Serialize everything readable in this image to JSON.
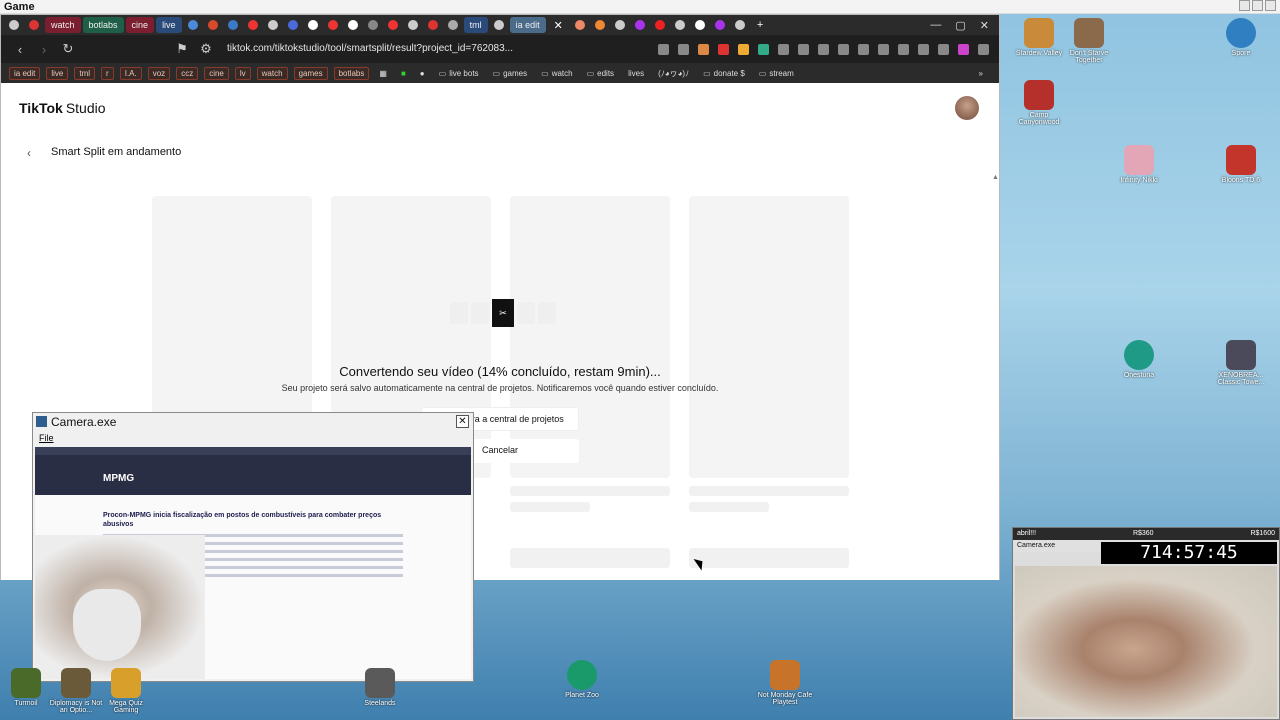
{
  "window": {
    "title": "Game"
  },
  "tabs": [
    "watch",
    "botlabs",
    "cine",
    "live",
    "tml",
    "ia edit"
  ],
  "browser": {
    "url": "tiktok.com/tiktokstudio/tool/smartsplit/result?project_id=762083...",
    "bookmarks": [
      "ia edit",
      "live",
      "tml",
      "r",
      "I.A.",
      "voz",
      "ccz",
      "cine",
      "lv",
      "watch",
      "games",
      "botlabs",
      "live bots",
      "games",
      "watch",
      "edits",
      "lives",
      "(ﾉ◕ヮ◕)ﾉ",
      "donate $",
      "stream"
    ]
  },
  "page": {
    "brand": "TikTok",
    "brand_suffix": "Studio",
    "back_icon": "chevron-left-icon",
    "title": "Smart Split em andamento",
    "progress": {
      "headline": "Convertendo seu vídeo (14% concluído, restam 9min)...",
      "subtext": "Seu projeto será salvo automaticamente na central de projetos. Notificaremos você quando estiver concluído.",
      "percent": 14
    },
    "primary_button": "Voltar para a central de projetos",
    "cancel_button": "Cancelar"
  },
  "camera_window": {
    "title": "Camera.exe",
    "menu": "File",
    "article_heading": "Procon-MPMG inicia fiscalização em postos de combustíveis para combater preços abusivos",
    "site_logo": "MPMG"
  },
  "desktop_icons": [
    {
      "label": "Stardew Valley",
      "color": "#c98a3a"
    },
    {
      "label": "Don't Starve Together",
      "color": "#8a6a4a"
    },
    {
      "label": "Spore",
      "color": "#2f7fc1"
    },
    {
      "label": "Camp Canyonwood",
      "color": "#b5302a"
    },
    {
      "label": "Infinity Nikki",
      "color": "#e3a6b6"
    },
    {
      "label": "Bloons TD 6",
      "color": "#c3342a"
    },
    {
      "label": "Onestuna",
      "color": "#1f9a86"
    },
    {
      "label": "XENOBREA... Classic Towe...",
      "color": "#4a4a5a"
    }
  ],
  "stream_overlay": {
    "left_text": "abril!!!",
    "mid_text": "R$360",
    "right_text": "R$1600",
    "camera_title": "Camera.exe",
    "timer": "714:57:45"
  },
  "taskbar_icons": [
    {
      "label": "Turmoil",
      "color": "#4a6a2a"
    },
    {
      "label": "Diplomacy is Not an Optio...",
      "color": "#6a5a3a"
    },
    {
      "label": "Mega Quiz Gaming",
      "color": "#d8a02a"
    },
    {
      "label": "Steelands",
      "color": "#5a5a5a"
    },
    {
      "label": "Planet Zoo",
      "color": "#1a9a6a"
    },
    {
      "label": "Not Monday Cafe Playtest",
      "color": "#c7742a"
    }
  ]
}
